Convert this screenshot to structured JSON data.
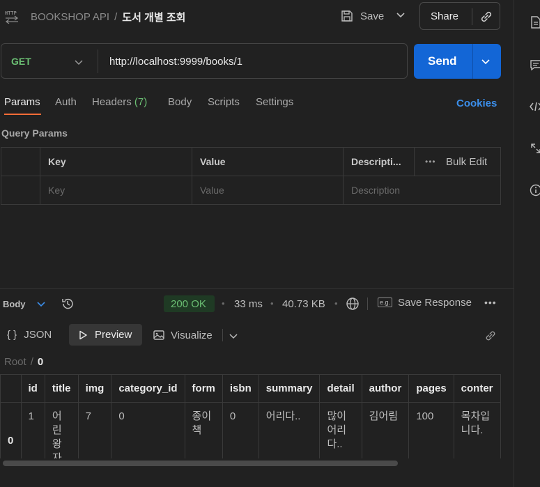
{
  "header": {
    "collection": "BOOKSHOP API",
    "separator": "/",
    "request_name": "도서 개별 조회",
    "save_label": "Save",
    "share_label": "Share"
  },
  "request": {
    "method": "GET",
    "url": "http://localhost:9999/books/1",
    "send_label": "Send"
  },
  "tabs": {
    "params": "Params",
    "auth": "Auth",
    "headers": "Headers",
    "headers_count": "(7)",
    "body": "Body",
    "scripts": "Scripts",
    "settings": "Settings",
    "cookies": "Cookies"
  },
  "query_params": {
    "title": "Query Params",
    "col_key": "Key",
    "col_value": "Value",
    "col_description": "Descripti...",
    "bulk_edit": "Bulk Edit",
    "ph_key": "Key",
    "ph_value": "Value",
    "ph_description": "Description"
  },
  "response": {
    "body_label": "Body",
    "status": "200 OK",
    "time": "33 ms",
    "size": "40.73 KB",
    "save_response": "Save Response",
    "save_response_badge": "e.g.",
    "view_json": "JSON",
    "view_json_glyph": "{ }",
    "view_preview": "Preview",
    "view_visualize": "Visualize",
    "root_label": "Root",
    "root_sep": "/",
    "root_index": "0"
  },
  "result_table": {
    "columns": [
      "id",
      "title",
      "img",
      "category_id",
      "form",
      "isbn",
      "summary",
      "detail",
      "author",
      "pages",
      "conter"
    ],
    "rows": [
      {
        "index": "0",
        "cells": [
          "1",
          "어린 왕자들",
          "7",
          "0",
          "종이책",
          "0",
          "어리다..",
          "많이 어리다..",
          "김어림",
          "100",
          "목차입니다."
        ]
      }
    ]
  },
  "colors": {
    "background": "#212121",
    "accent_blue": "#1366d6",
    "status_green": "#6bbf73",
    "tab_underline": "#ff6c37"
  }
}
